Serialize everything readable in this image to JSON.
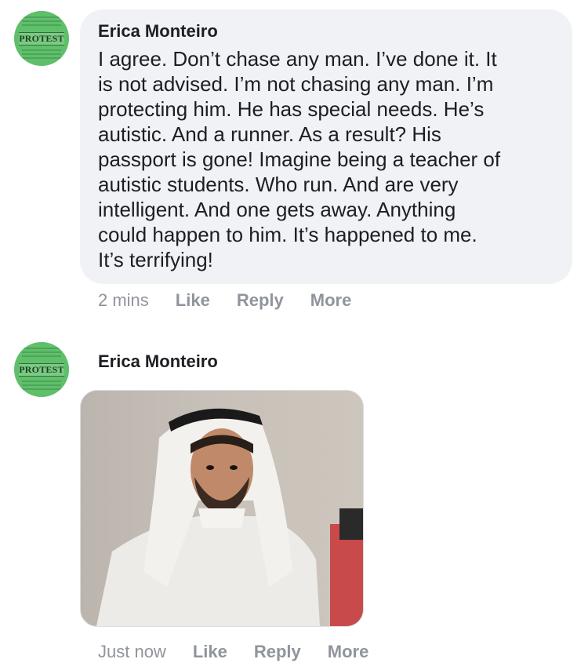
{
  "comments": [
    {
      "author": "Erica Monteiro",
      "avatar_text": "PROTEST",
      "text": "I agree. Don’t chase any man. I’ve done it. It\nis not advised. I’m not chasing any man. I’m\nprotecting him. He has special needs. He’s\nautistic. And a runner. As a result? His\npassport is gone! Imagine being a teacher of\nautistic students. Who run. And are very\nintelligent. And one gets away. Anything\ncould happen to him. It’s happened to me.\nIt’s terrifying!",
      "time": "2 mins",
      "actions": [
        "Like",
        "Reply",
        "More"
      ]
    },
    {
      "author": "Erica Monteiro",
      "avatar_text": "PROTEST",
      "attachment": "photo",
      "time": "Just now",
      "actions": [
        "Like",
        "Reply",
        "More"
      ]
    }
  ],
  "colors": {
    "bubble_bg": "#f0f2f5",
    "meta_text": "#90949c",
    "avatar_bg": "#5fbf6a"
  }
}
